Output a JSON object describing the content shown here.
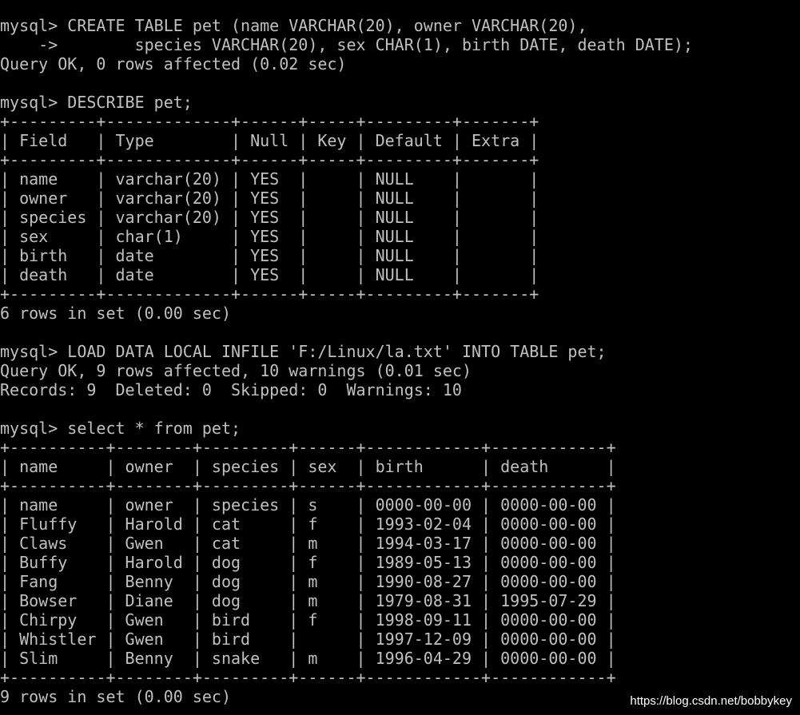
{
  "terminal": {
    "lines": [
      "mysql> CREATE TABLE pet (name VARCHAR(20), owner VARCHAR(20),",
      "    ->        species VARCHAR(20), sex CHAR(1), birth DATE, death DATE);",
      "Query OK, 0 rows affected (0.02 sec)",
      "",
      "mysql> DESCRIBE pet;",
      "+---------+-------------+------+-----+---------+-------+",
      "| Field   | Type        | Null | Key | Default | Extra |",
      "+---------+-------------+------+-----+---------+-------+",
      "| name    | varchar(20) | YES  |     | NULL    |       |",
      "| owner   | varchar(20) | YES  |     | NULL    |       |",
      "| species | varchar(20) | YES  |     | NULL    |       |",
      "| sex     | char(1)     | YES  |     | NULL    |       |",
      "| birth   | date        | YES  |     | NULL    |       |",
      "| death   | date        | YES  |     | NULL    |       |",
      "+---------+-------------+------+-----+---------+-------+",
      "6 rows in set (0.00 sec)",
      "",
      "mysql> LOAD DATA LOCAL INFILE 'F:/Linux/la.txt' INTO TABLE pet;",
      "Query OK, 9 rows affected, 10 warnings (0.01 sec)",
      "Records: 9  Deleted: 0  Skipped: 0  Warnings: 10",
      "",
      "mysql> select * from pet;",
      "+----------+--------+---------+------+------------+------------+",
      "| name     | owner  | species | sex  | birth      | death      |",
      "+----------+--------+---------+------+------------+------------+",
      "| name     | owner  | species | s    | 0000-00-00 | 0000-00-00 |",
      "| Fluffy   | Harold | cat     | f    | 1993-02-04 | 0000-00-00 |",
      "| Claws    | Gwen   | cat     | m    | 1994-03-17 | 0000-00-00 |",
      "| Buffy    | Harold | dog     | f    | 1989-05-13 | 0000-00-00 |",
      "| Fang     | Benny  | dog     | m    | 1990-08-27 | 0000-00-00 |",
      "| Bowser   | Diane  | dog     | m    | 1979-08-31 | 1995-07-29 |",
      "| Chirpy   | Gwen   | bird    | f    | 1998-09-11 | 0000-00-00 |",
      "| Whistler | Gwen   | bird    |      | 1997-12-09 | 0000-00-00 |",
      "| Slim     | Benny  | snake   | m    | 1996-04-29 | 0000-00-00 |",
      "+----------+--------+---------+------+------------+------------+",
      "9 rows in set (0.00 sec)"
    ]
  },
  "watermark": {
    "text": "https://blog.csdn.net/bobbykey"
  },
  "colors": {
    "background": "#000000",
    "foreground": "#c0c0c0",
    "watermark": "#ffffff"
  }
}
